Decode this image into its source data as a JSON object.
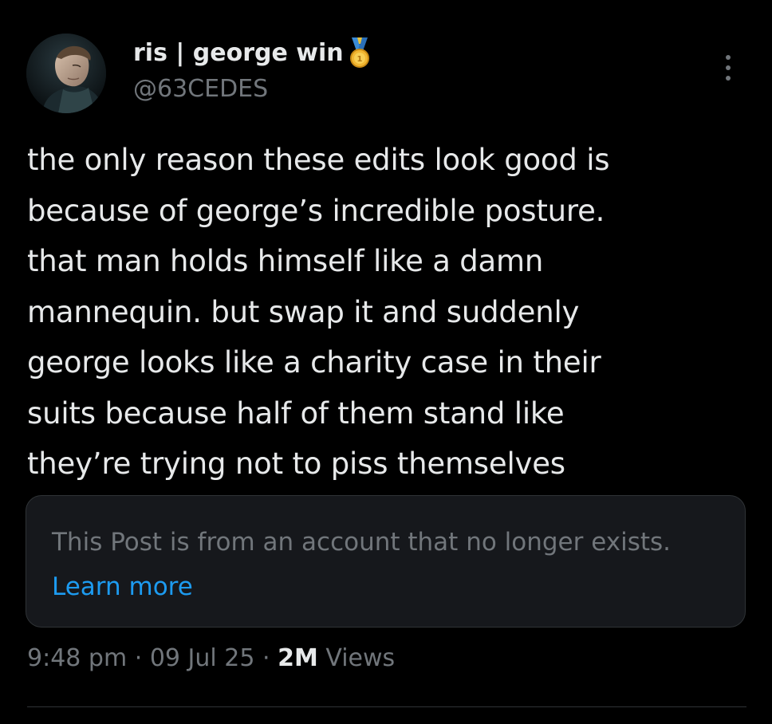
{
  "author": {
    "display_name": "ris | george win",
    "handle": "@63CEDES",
    "badge_icon": "gold-medal-icon"
  },
  "post": {
    "text": "the only reason these edits look good is\nbecause of george’s incredible posture.\nthat man holds himself like a damn\nmannequin. but swap it and suddenly\ngeorge looks like a charity case in their\nsuits because half of them stand like\nthey’re trying not to piss themselves"
  },
  "notice": {
    "text": "This Post is from an account that no longer exists.",
    "link_label": "Learn more"
  },
  "meta": {
    "time": "9:48 pm",
    "separator": "·",
    "date": "09 Jul 25",
    "views_count": "2M",
    "views_label": "Views"
  },
  "colors": {
    "background": "#000000",
    "primary_text": "#e7e9ea",
    "secondary_text": "#71767b",
    "link": "#1d9bf0",
    "card_background": "#16181c"
  }
}
